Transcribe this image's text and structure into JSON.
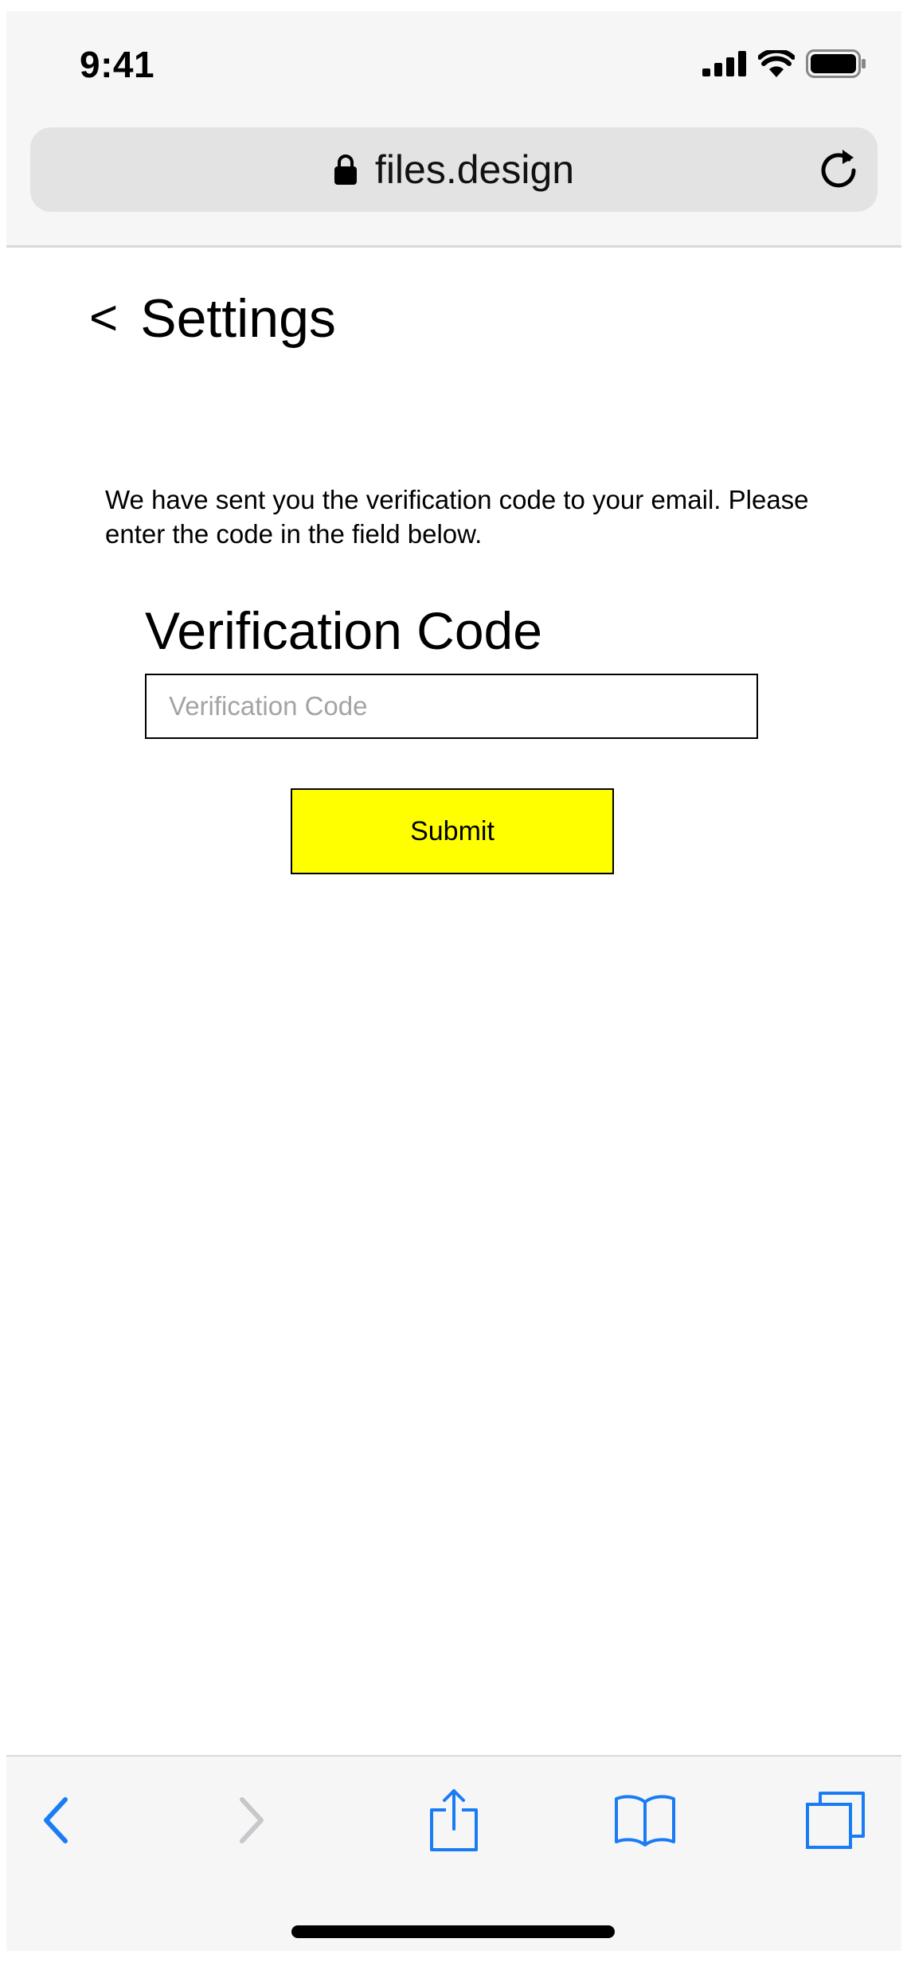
{
  "status_bar": {
    "time": "9:41",
    "icons": [
      "cellular-signal-icon",
      "wifi-icon",
      "battery-icon"
    ]
  },
  "browser": {
    "url": "files.design",
    "lock_icon": "lock-icon",
    "reload_icon": "reload-icon"
  },
  "page": {
    "back_chevron": "<",
    "title": "Settings",
    "info_text": "We have sent you the verification code to your email. Please enter the code in the field below.",
    "code_label": "Verification Code",
    "code_input": {
      "value": "",
      "placeholder": "Verification Code"
    },
    "submit_label": "Submit"
  },
  "toolbar": {
    "items": [
      "back-icon",
      "forward-icon",
      "share-icon",
      "bookmarks-icon",
      "tabs-icon"
    ]
  },
  "colors": {
    "accent": "#1a7cf5",
    "disabled": "#c7c7cc",
    "submit_bg": "#ffff00",
    "chrome_bg": "#f6f6f6"
  }
}
